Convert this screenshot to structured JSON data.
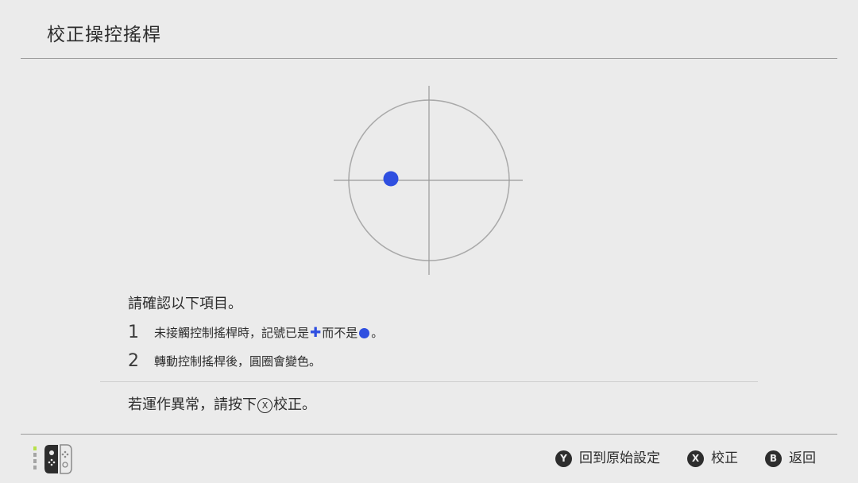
{
  "header": {
    "title": "校正操控搖桿"
  },
  "stick_readout": {
    "marker_color": "#2f4fe0"
  },
  "instructions": {
    "heading": "請確認以下項目。",
    "items": [
      {
        "number": "1",
        "text_before": "未接觸控制搖桿時，記號已是",
        "plus_glyph": "✚",
        "text_middle": "而不是",
        "text_after": "。"
      },
      {
        "number": "2",
        "text": "轉動控制搖桿後，圓圈會變色。"
      }
    ],
    "warning_before": "若運作異常，請按下",
    "warning_button": "X",
    "warning_after": "校正。"
  },
  "footer": {
    "actions": [
      {
        "button": "Y",
        "label": "回到原始設定"
      },
      {
        "button": "X",
        "label": "校正"
      },
      {
        "button": "B",
        "label": "返回"
      }
    ]
  }
}
